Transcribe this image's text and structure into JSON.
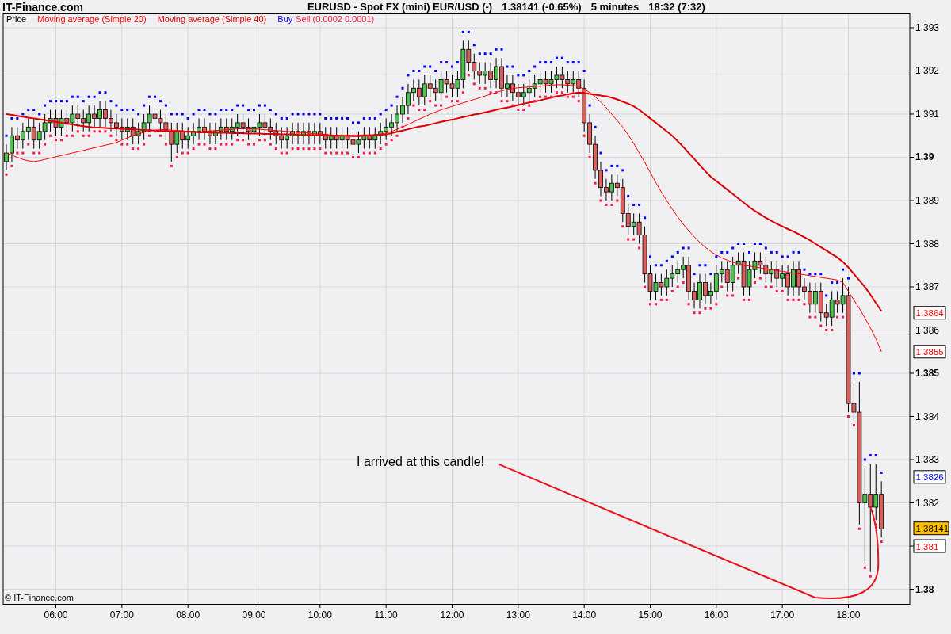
{
  "site": "IT-Finance.com",
  "title": [
    "EURUSD - Spot FX (mini) EUR/USD (-)",
    "1.38141 (-0.65%)",
    "5 minutes",
    "18:32 (7:32)"
  ],
  "chart": {
    "legend": [
      {
        "label": "Price",
        "color": "#000000"
      }
    ],
    "copyright": "© IT-Finance.com",
    "price_tags": [
      {
        "label": "1.3864",
        "color": "#ff0000",
        "kind": "plain"
      },
      {
        "label": "1.3855",
        "color": "#ff0000",
        "kind": "plain"
      },
      {
        "label": "1.3826",
        "color": "#0000ff",
        "kind": "plain"
      },
      {
        "label": "1.38141",
        "color": "#ffc000",
        "kind": "current"
      },
      {
        "label": "1.381",
        "color": "#ff0000",
        "kind": "plain"
      }
    ],
    "chart_data": {
      "type": "candlestick",
      "grid": true,
      "xlim": [
        312.12,
        1135.8
      ],
      "ylim": [
        1.379661,
        1.39333
      ],
      "x": [
        315,
        320,
        325,
        330,
        335,
        340,
        345,
        350,
        355,
        360,
        365,
        370,
        375,
        380,
        385,
        390,
        395,
        400,
        405,
        410,
        415,
        420,
        425,
        430,
        435,
        440,
        445,
        450,
        455,
        460,
        465,
        470,
        475,
        480,
        485,
        490,
        495,
        500,
        505,
        510,
        515,
        520,
        525,
        530,
        535,
        540,
        545,
        550,
        555,
        560,
        565,
        570,
        575,
        580,
        585,
        590,
        595,
        600,
        605,
        610,
        615,
        620,
        625,
        630,
        635,
        640,
        645,
        650,
        655,
        660,
        665,
        670,
        675,
        680,
        685,
        690,
        695,
        700,
        705,
        710,
        715,
        720,
        725,
        730,
        735,
        740,
        745,
        750,
        755,
        760,
        765,
        770,
        775,
        780,
        785,
        790,
        795,
        800,
        805,
        810,
        815,
        820,
        825,
        830,
        835,
        840,
        845,
        850,
        855,
        860,
        865,
        870,
        875,
        880,
        885,
        890,
        895,
        900,
        905,
        910,
        915,
        920,
        925,
        930,
        935,
        940,
        945,
        950,
        955,
        960,
        965,
        970,
        975,
        980,
        985,
        990,
        995,
        1000,
        1005,
        1010,
        1015,
        1020,
        1025,
        1030,
        1035,
        1040,
        1045,
        1050,
        1055,
        1060,
        1065,
        1070,
        1075,
        1080,
        1085,
        1090,
        1095,
        1100,
        1105,
        1110
      ],
      "ohlc": [
        [
          1.3899,
          1.3903,
          1.3897,
          1.3901
        ],
        [
          1.3901,
          1.3907,
          1.3899,
          1.3905
        ],
        [
          1.3905,
          1.3907,
          1.3902,
          1.3904
        ],
        [
          1.3904,
          1.3908,
          1.3902,
          1.3906
        ],
        [
          1.3906,
          1.3909,
          1.3904,
          1.3907
        ],
        [
          1.3907,
          1.3909,
          1.3902,
          1.3904
        ],
        [
          1.3904,
          1.3908,
          1.3902,
          1.3906
        ],
        [
          1.3906,
          1.391,
          1.3904,
          1.3908
        ],
        [
          1.3908,
          1.3911,
          1.3906,
          1.3909
        ],
        [
          1.3909,
          1.3911,
          1.3905,
          1.3907
        ],
        [
          1.3907,
          1.3911,
          1.3905,
          1.3909
        ],
        [
          1.3909,
          1.3911,
          1.3906,
          1.3908
        ],
        [
          1.3908,
          1.3912,
          1.3906,
          1.391
        ],
        [
          1.391,
          1.3912,
          1.3907,
          1.3909
        ],
        [
          1.3909,
          1.3911,
          1.3906,
          1.3908
        ],
        [
          1.3908,
          1.3912,
          1.3906,
          1.391
        ],
        [
          1.391,
          1.3912,
          1.3907,
          1.3909
        ],
        [
          1.3909,
          1.3913,
          1.3907,
          1.3911
        ],
        [
          1.3911,
          1.3913,
          1.3907,
          1.3909
        ],
        [
          1.3909,
          1.3911,
          1.3906,
          1.3908
        ],
        [
          1.3908,
          1.391,
          1.3905,
          1.3907
        ],
        [
          1.3907,
          1.3909,
          1.3904,
          1.3906
        ],
        [
          1.3906,
          1.3909,
          1.3904,
          1.3907
        ],
        [
          1.3907,
          1.3909,
          1.3903,
          1.3905
        ],
        [
          1.3905,
          1.3908,
          1.3903,
          1.3906
        ],
        [
          1.3906,
          1.391,
          1.3904,
          1.3908
        ],
        [
          1.3908,
          1.3912,
          1.3906,
          1.391
        ],
        [
          1.391,
          1.3912,
          1.3907,
          1.3909
        ],
        [
          1.3909,
          1.3911,
          1.3906,
          1.3908
        ],
        [
          1.3908,
          1.391,
          1.3904,
          1.3906
        ],
        [
          1.3906,
          1.3908,
          1.3899,
          1.3903
        ],
        [
          1.3903,
          1.3908,
          1.3901,
          1.3906
        ],
        [
          1.3906,
          1.3908,
          1.3902,
          1.3904
        ],
        [
          1.3904,
          1.3907,
          1.3902,
          1.3905
        ],
        [
          1.3905,
          1.3908,
          1.3903,
          1.3906
        ],
        [
          1.3906,
          1.3909,
          1.3904,
          1.3907
        ],
        [
          1.3907,
          1.3909,
          1.3904,
          1.3906
        ],
        [
          1.3906,
          1.3908,
          1.3903,
          1.3905
        ],
        [
          1.3905,
          1.3908,
          1.3903,
          1.3906
        ],
        [
          1.3906,
          1.3909,
          1.3904,
          1.3907
        ],
        [
          1.3907,
          1.3909,
          1.3904,
          1.3906
        ],
        [
          1.3906,
          1.3909,
          1.3904,
          1.3907
        ],
        [
          1.3907,
          1.391,
          1.3905,
          1.3908
        ],
        [
          1.3908,
          1.391,
          1.3905,
          1.3907
        ],
        [
          1.3907,
          1.3909,
          1.3904,
          1.3906
        ],
        [
          1.3906,
          1.3909,
          1.3904,
          1.3907
        ],
        [
          1.3907,
          1.391,
          1.3905,
          1.3908
        ],
        [
          1.3908,
          1.391,
          1.3905,
          1.3907
        ],
        [
          1.3907,
          1.3909,
          1.3904,
          1.3906
        ],
        [
          1.3906,
          1.3908,
          1.3903,
          1.3905
        ],
        [
          1.3905,
          1.3907,
          1.3902,
          1.3904
        ],
        [
          1.3904,
          1.3907,
          1.3902,
          1.3905
        ],
        [
          1.3905,
          1.3908,
          1.3903,
          1.3906
        ],
        [
          1.3906,
          1.3908,
          1.3903,
          1.3905
        ],
        [
          1.3905,
          1.3908,
          1.3903,
          1.3906
        ],
        [
          1.3906,
          1.3908,
          1.3903,
          1.3905
        ],
        [
          1.3905,
          1.3908,
          1.3903,
          1.3906
        ],
        [
          1.3906,
          1.3908,
          1.3903,
          1.3905
        ],
        [
          1.3905,
          1.3907,
          1.3902,
          1.3904
        ],
        [
          1.3904,
          1.3907,
          1.3902,
          1.3905
        ],
        [
          1.3905,
          1.3907,
          1.3902,
          1.3904
        ],
        [
          1.3904,
          1.3907,
          1.3902,
          1.3905
        ],
        [
          1.3905,
          1.3907,
          1.3902,
          1.3904
        ],
        [
          1.3904,
          1.3906,
          1.3901,
          1.3903
        ],
        [
          1.3903,
          1.3906,
          1.3901,
          1.3904
        ],
        [
          1.3904,
          1.3907,
          1.3902,
          1.3905
        ],
        [
          1.3905,
          1.3907,
          1.3902,
          1.3904
        ],
        [
          1.3904,
          1.3907,
          1.3902,
          1.3905
        ],
        [
          1.3905,
          1.3908,
          1.3903,
          1.3906
        ],
        [
          1.3906,
          1.3909,
          1.3904,
          1.3907
        ],
        [
          1.3907,
          1.391,
          1.3905,
          1.3908
        ],
        [
          1.3908,
          1.3912,
          1.3906,
          1.391
        ],
        [
          1.391,
          1.3914,
          1.3908,
          1.3912
        ],
        [
          1.3912,
          1.3917,
          1.391,
          1.3915
        ],
        [
          1.3915,
          1.3918,
          1.3913,
          1.3916
        ],
        [
          1.3916,
          1.3918,
          1.3912,
          1.3914
        ],
        [
          1.3914,
          1.3919,
          1.3912,
          1.3917
        ],
        [
          1.3917,
          1.3919,
          1.3914,
          1.3916
        ],
        [
          1.3916,
          1.3918,
          1.3913,
          1.3915
        ],
        [
          1.3915,
          1.392,
          1.3913,
          1.3918
        ],
        [
          1.3918,
          1.392,
          1.3915,
          1.3917
        ],
        [
          1.3917,
          1.3919,
          1.3914,
          1.3916
        ],
        [
          1.3916,
          1.392,
          1.3914,
          1.3918
        ],
        [
          1.3918,
          1.3927,
          1.3916,
          1.3925
        ],
        [
          1.3925,
          1.3927,
          1.392,
          1.3922
        ],
        [
          1.3922,
          1.3924,
          1.3918,
          1.392
        ],
        [
          1.392,
          1.3922,
          1.3917,
          1.3919
        ],
        [
          1.3919,
          1.3922,
          1.3917,
          1.392
        ],
        [
          1.392,
          1.3922,
          1.3916,
          1.3918
        ],
        [
          1.3918,
          1.3923,
          1.3916,
          1.3921
        ],
        [
          1.3921,
          1.3923,
          1.3914,
          1.3916
        ],
        [
          1.3916,
          1.3919,
          1.3914,
          1.3917
        ],
        [
          1.3917,
          1.3919,
          1.3913,
          1.3915
        ],
        [
          1.3915,
          1.3917,
          1.3912,
          1.3914
        ],
        [
          1.3914,
          1.3917,
          1.3912,
          1.3915
        ],
        [
          1.3915,
          1.3918,
          1.3913,
          1.3916
        ],
        [
          1.3916,
          1.3919,
          1.3914,
          1.3917
        ],
        [
          1.3917,
          1.392,
          1.3915,
          1.3918
        ],
        [
          1.3918,
          1.392,
          1.3915,
          1.3917
        ],
        [
          1.3917,
          1.392,
          1.3915,
          1.3918
        ],
        [
          1.3918,
          1.3921,
          1.3916,
          1.3919
        ],
        [
          1.3919,
          1.3921,
          1.3916,
          1.3918
        ],
        [
          1.3918,
          1.392,
          1.3915,
          1.3917
        ],
        [
          1.3917,
          1.392,
          1.3915,
          1.3918
        ],
        [
          1.3918,
          1.392,
          1.3914,
          1.3916
        ],
        [
          1.3916,
          1.3918,
          1.3906,
          1.3908
        ],
        [
          1.3908,
          1.391,
          1.3901,
          1.3903
        ],
        [
          1.3903,
          1.3905,
          1.3895,
          1.3897
        ],
        [
          1.3897,
          1.3899,
          1.3891,
          1.3893
        ],
        [
          1.3893,
          1.3895,
          1.389,
          1.3892
        ],
        [
          1.3892,
          1.3896,
          1.389,
          1.3894
        ],
        [
          1.3894,
          1.3896,
          1.3891,
          1.3893
        ],
        [
          1.3893,
          1.3895,
          1.3885,
          1.3887
        ],
        [
          1.3887,
          1.3889,
          1.3882,
          1.3884
        ],
        [
          1.3884,
          1.3887,
          1.3882,
          1.3885
        ],
        [
          1.3885,
          1.3887,
          1.388,
          1.3882
        ],
        [
          1.3882,
          1.3884,
          1.3871,
          1.3873
        ],
        [
          1.3873,
          1.3875,
          1.3867,
          1.3869
        ],
        [
          1.3869,
          1.3873,
          1.3867,
          1.3871
        ],
        [
          1.3871,
          1.3873,
          1.3868,
          1.387
        ],
        [
          1.387,
          1.3874,
          1.3868,
          1.3872
        ],
        [
          1.3872,
          1.3875,
          1.387,
          1.3873
        ],
        [
          1.3873,
          1.3876,
          1.3871,
          1.3874
        ],
        [
          1.3874,
          1.3877,
          1.3872,
          1.3875
        ],
        [
          1.3875,
          1.3877,
          1.3867,
          1.3869
        ],
        [
          1.3869,
          1.3871,
          1.3865,
          1.3867
        ],
        [
          1.3867,
          1.3873,
          1.3865,
          1.3871
        ],
        [
          1.3871,
          1.3873,
          1.3866,
          1.3868
        ],
        [
          1.3868,
          1.3871,
          1.3866,
          1.3869
        ],
        [
          1.3869,
          1.3875,
          1.3867,
          1.3873
        ],
        [
          1.3873,
          1.3876,
          1.3871,
          1.3874
        ],
        [
          1.3874,
          1.3876,
          1.3869,
          1.3871
        ],
        [
          1.3871,
          1.3877,
          1.3869,
          1.3875
        ],
        [
          1.3875,
          1.3878,
          1.3873,
          1.3876
        ],
        [
          1.3876,
          1.3878,
          1.3868,
          1.387
        ],
        [
          1.387,
          1.3876,
          1.3868,
          1.3874
        ],
        [
          1.3874,
          1.3878,
          1.3872,
          1.3876
        ],
        [
          1.3876,
          1.3878,
          1.3873,
          1.3875
        ],
        [
          1.3875,
          1.3877,
          1.3871,
          1.3873
        ],
        [
          1.3873,
          1.3876,
          1.3871,
          1.3874
        ],
        [
          1.3874,
          1.3876,
          1.387,
          1.3872
        ],
        [
          1.3872,
          1.3875,
          1.387,
          1.3873
        ],
        [
          1.3873,
          1.3875,
          1.3868,
          1.387
        ],
        [
          1.387,
          1.3876,
          1.3868,
          1.3874
        ],
        [
          1.3874,
          1.3876,
          1.3868,
          1.387
        ],
        [
          1.387,
          1.3872,
          1.3867,
          1.3869
        ],
        [
          1.3869,
          1.3871,
          1.3864,
          1.3866
        ],
        [
          1.3866,
          1.3871,
          1.3864,
          1.3869
        ],
        [
          1.3869,
          1.3871,
          1.3862,
          1.3864
        ],
        [
          1.3864,
          1.3866,
          1.3861,
          1.3863
        ],
        [
          1.3863,
          1.3869,
          1.3861,
          1.3867
        ],
        [
          1.3867,
          1.3869,
          1.3864,
          1.3866
        ],
        [
          1.3866,
          1.3872,
          1.3864,
          1.3868
        ],
        [
          1.3868,
          1.387,
          1.3841,
          1.3843
        ],
        [
          1.3843,
          1.3848,
          1.3839,
          1.3841
        ],
        [
          1.3841,
          1.3848,
          1.3815,
          1.382
        ],
        [
          1.382,
          1.3828,
          1.3806,
          1.3822
        ],
        [
          1.3822,
          1.3829,
          1.3804,
          1.3819
        ],
        [
          1.3819,
          1.3829,
          1.3816,
          1.3822
        ],
        [
          1.3822,
          1.3825,
          1.3812,
          1.3814
        ]
      ],
      "series": [
        {
          "name": "Moving average (Simple 20)",
          "type": "line",
          "color": "#ff0000",
          "values": [
            1.3901,
            1.39005,
            1.39,
            1.38995,
            1.38992,
            1.3899,
            1.38992,
            1.38995,
            1.38998,
            1.39001,
            1.39004,
            1.39007,
            1.3901,
            1.39013,
            1.39016,
            1.39019,
            1.39022,
            1.39025,
            1.39028,
            1.39031,
            1.39034,
            1.3904,
            1.39045,
            1.3905,
            1.39054,
            1.39058,
            1.39061,
            1.39063,
            1.39064,
            1.39064,
            1.39063,
            1.39062,
            1.39061,
            1.3906,
            1.39059,
            1.39059,
            1.3906,
            1.39061,
            1.39062,
            1.39063,
            1.39064,
            1.39065,
            1.39066,
            1.39066,
            1.39066,
            1.39066,
            1.39065,
            1.39064,
            1.39063,
            1.39062,
            1.39061,
            1.3906,
            1.39059,
            1.39058,
            1.39057,
            1.39056,
            1.39055,
            1.39054,
            1.39053,
            1.39052,
            1.39051,
            1.3905,
            1.39049,
            1.39048,
            1.39048,
            1.39049,
            1.3905,
            1.39052,
            1.39054,
            1.39056,
            1.3906,
            1.39065,
            1.3907,
            1.39076,
            1.39082,
            1.39088,
            1.39094,
            1.391,
            1.39105,
            1.3911,
            1.39114,
            1.39118,
            1.39122,
            1.39126,
            1.3913,
            1.39134,
            1.39138,
            1.39142,
            1.39146,
            1.3915,
            1.39154,
            1.39157,
            1.39159,
            1.39161,
            1.39162,
            1.39163,
            1.39164,
            1.39165,
            1.39166,
            1.39167,
            1.39168,
            1.39168,
            1.39167,
            1.39166,
            1.39164,
            1.39158,
            1.3915,
            1.3914,
            1.39128,
            1.39115,
            1.391,
            1.39085,
            1.3907,
            1.39052,
            1.39032,
            1.3901,
            1.38988,
            1.38965,
            1.38942,
            1.3892,
            1.389,
            1.3888,
            1.38862,
            1.38845,
            1.3883,
            1.38816,
            1.38803,
            1.38792,
            1.38782,
            1.38774,
            1.38767,
            1.38762,
            1.38757,
            1.38753,
            1.3875,
            1.38748,
            1.38746,
            1.38744,
            1.38742,
            1.3874,
            1.38738,
            1.38736,
            1.38734,
            1.38732,
            1.3873,
            1.38728,
            1.38726,
            1.38724,
            1.38722,
            1.3872,
            1.38718,
            1.38716,
            1.3871,
            1.3869,
            1.3867,
            1.3865,
            1.38628,
            1.38605,
            1.3858,
            1.3855
          ]
        },
        {
          "name": "Moving average (Simple 40)",
          "type": "line",
          "color": "#dd0000",
          "values": [
            1.391,
            1.39098,
            1.39096,
            1.39094,
            1.39092,
            1.3909,
            1.39088,
            1.39086,
            1.39084,
            1.39082,
            1.3908,
            1.39078,
            1.39076,
            1.39074,
            1.39072,
            1.3907,
            1.39069,
            1.39069,
            1.39068,
            1.39067,
            1.39067,
            1.39066,
            1.39065,
            1.39065,
            1.39064,
            1.39063,
            1.39063,
            1.39062,
            1.39061,
            1.39061,
            1.3906,
            1.3906,
            1.3906,
            1.39059,
            1.39059,
            1.39058,
            1.39058,
            1.39058,
            1.39057,
            1.39057,
            1.39057,
            1.39056,
            1.39056,
            1.39056,
            1.39055,
            1.39055,
            1.39055,
            1.39054,
            1.39054,
            1.39054,
            1.39053,
            1.39053,
            1.39053,
            1.39052,
            1.39052,
            1.39052,
            1.39051,
            1.39051,
            1.39051,
            1.3905,
            1.3905,
            1.3905,
            1.3905,
            1.3905,
            1.3905,
            1.39051,
            1.39051,
            1.39052,
            1.39052,
            1.39053,
            1.39056,
            1.39059,
            1.39062,
            1.39065,
            1.39068,
            1.39071,
            1.39073,
            1.39076,
            1.39079,
            1.39082,
            1.39085,
            1.39087,
            1.3909,
            1.39093,
            1.39096,
            1.39099,
            1.39101,
            1.39104,
            1.39107,
            1.3911,
            1.39113,
            1.39115,
            1.39118,
            1.39121,
            1.39124,
            1.39127,
            1.39129,
            1.39132,
            1.39135,
            1.39138,
            1.39141,
            1.39143,
            1.39146,
            1.39148,
            1.3915,
            1.39149,
            1.39147,
            1.39145,
            1.39143,
            1.39141,
            1.39138,
            1.39134,
            1.39129,
            1.39124,
            1.39118,
            1.3911,
            1.391,
            1.3909,
            1.3908,
            1.3907,
            1.3906,
            1.3905,
            1.39037,
            1.39024,
            1.3901,
            1.38996,
            1.38982,
            1.38968,
            1.38955,
            1.38945,
            1.38935,
            1.38925,
            1.38915,
            1.38905,
            1.38895,
            1.38885,
            1.38876,
            1.38868,
            1.3886,
            1.38853,
            1.38846,
            1.3884,
            1.38834,
            1.38828,
            1.38822,
            1.38815,
            1.38808,
            1.388,
            1.38792,
            1.38784,
            1.38776,
            1.38768,
            1.38758,
            1.38745,
            1.3873,
            1.38715,
            1.387,
            1.38682,
            1.38663,
            1.38644
          ]
        },
        {
          "name": "Buy",
          "type": "scatter",
          "color": "#0000ff",
          "values": [
            1.3905,
            1.3909,
            1.3909,
            1.391,
            1.3911,
            1.3911,
            1.391,
            1.3912,
            1.3913,
            1.3913,
            1.3913,
            1.3913,
            1.3914,
            1.3914,
            1.3913,
            1.3914,
            1.3914,
            1.3915,
            1.3915,
            1.3913,
            1.3912,
            1.3911,
            1.3911,
            1.3911,
            1.391,
            1.3912,
            1.3914,
            1.3914,
            1.3913,
            1.3912,
            1.391,
            1.391,
            1.391,
            1.3909,
            1.391,
            1.3911,
            1.3911,
            1.391,
            1.391,
            1.3911,
            1.3911,
            1.3911,
            1.3912,
            1.3912,
            1.3911,
            1.3911,
            1.3912,
            1.3912,
            1.3911,
            1.391,
            1.3909,
            1.3909,
            1.391,
            1.391,
            1.391,
            1.391,
            1.391,
            1.391,
            1.3909,
            1.3909,
            1.3909,
            1.3909,
            1.3909,
            1.3908,
            1.3908,
            1.3909,
            1.3909,
            1.3909,
            1.391,
            1.3911,
            1.3912,
            1.3914,
            1.3916,
            1.3919,
            1.392,
            1.392,
            1.3921,
            1.3921,
            1.392,
            1.3922,
            1.3922,
            1.3921,
            1.3922,
            1.3929,
            1.3929,
            1.3926,
            1.3924,
            1.3924,
            1.3924,
            1.3925,
            1.3925,
            1.3921,
            1.3921,
            1.3919,
            1.3919,
            1.392,
            1.3921,
            1.3922,
            1.3922,
            1.3922,
            1.3923,
            1.3923,
            1.3922,
            1.3922,
            1.3922,
            1.392,
            1.3912,
            1.3907,
            1.3901,
            1.3897,
            1.3898,
            1.3898,
            1.3897,
            1.3891,
            1.3889,
            1.3889,
            1.3886,
            1.3877,
            1.3875,
            1.3875,
            1.3876,
            1.3877,
            1.3878,
            1.3879,
            1.3879,
            1.3873,
            1.3875,
            1.3875,
            1.3873,
            1.3877,
            1.3878,
            1.3878,
            1.3879,
            1.388,
            1.388,
            1.3878,
            1.388,
            1.388,
            1.3879,
            1.3878,
            1.3878,
            1.3877,
            1.3877,
            1.3878,
            1.3878,
            1.3874,
            1.3873,
            1.3873,
            1.3873,
            1.3868,
            1.3871,
            1.3871,
            1.3874,
            1.3872,
            1.385,
            1.385,
            1.383,
            1.3831,
            1.3831,
            1.3827
          ]
        },
        {
          "name": "Sell (0.0002 0.0001)",
          "type": "scatter",
          "color": "#ff1744",
          "values": [
            1.3896,
            1.3898,
            1.3901,
            1.3901,
            1.3903,
            1.3901,
            1.3901,
            1.3903,
            1.3905,
            1.3904,
            1.3904,
            1.3905,
            1.3905,
            1.3906,
            1.3905,
            1.3905,
            1.3906,
            1.3906,
            1.3906,
            1.3905,
            1.3904,
            1.3903,
            1.3903,
            1.3902,
            1.3902,
            1.3903,
            1.3905,
            1.3906,
            1.3905,
            1.3903,
            1.3898,
            1.39,
            1.3901,
            1.3901,
            1.3902,
            1.3903,
            1.3903,
            1.3902,
            1.3902,
            1.3903,
            1.3903,
            1.3903,
            1.3904,
            1.3904,
            1.3903,
            1.3903,
            1.3904,
            1.3904,
            1.3903,
            1.3902,
            1.3901,
            1.3901,
            1.3902,
            1.3902,
            1.3902,
            1.3902,
            1.3902,
            1.3902,
            1.3901,
            1.3901,
            1.3901,
            1.3901,
            1.3901,
            1.39,
            1.39,
            1.3901,
            1.3901,
            1.3901,
            1.3902,
            1.3903,
            1.3904,
            1.3905,
            1.3907,
            1.3909,
            1.3912,
            1.3911,
            1.3911,
            1.3913,
            1.3912,
            1.3912,
            1.3914,
            1.3913,
            1.3913,
            1.3915,
            1.3919,
            1.3917,
            1.3916,
            1.3916,
            1.3915,
            1.3915,
            1.3913,
            1.3913,
            1.3912,
            1.3911,
            1.3911,
            1.3912,
            1.3913,
            1.3914,
            1.3914,
            1.3914,
            1.3915,
            1.3915,
            1.3914,
            1.3914,
            1.3913,
            1.3905,
            1.39,
            1.3894,
            1.389,
            1.3889,
            1.3889,
            1.389,
            1.3884,
            1.3881,
            1.3881,
            1.3879,
            1.387,
            1.3866,
            1.3866,
            1.3867,
            1.3867,
            1.3869,
            1.387,
            1.3871,
            1.3866,
            1.3864,
            1.3864,
            1.3865,
            1.3865,
            1.3866,
            1.387,
            1.3868,
            1.3868,
            1.3872,
            1.3867,
            1.3867,
            1.3871,
            1.3872,
            1.387,
            1.387,
            1.3869,
            1.3869,
            1.3867,
            1.3867,
            1.3867,
            1.3866,
            1.3863,
            1.3863,
            1.3861,
            1.386,
            1.386,
            1.3863,
            1.3863,
            1.384,
            1.3838,
            1.3814,
            1.3805,
            1.3803,
            1.3815,
            1.3811
          ]
        }
      ],
      "xticks": [
        {
          "value": 360,
          "label": "06:00"
        },
        {
          "value": 420,
          "label": "07:00"
        },
        {
          "value": 480,
          "label": "08:00"
        },
        {
          "value": 540,
          "label": "09:00"
        },
        {
          "value": 600,
          "label": "10:00"
        },
        {
          "value": 660,
          "label": "11:00"
        },
        {
          "value": 720,
          "label": "12:00"
        },
        {
          "value": 780,
          "label": "13:00"
        },
        {
          "value": 840,
          "label": "14:00"
        },
        {
          "value": 900,
          "label": "15:00"
        },
        {
          "value": 960,
          "label": "16:00"
        },
        {
          "value": 1020,
          "label": "17:00"
        },
        {
          "value": 1080,
          "label": "18:00"
        }
      ],
      "yticks": [
        {
          "value": 1.38,
          "label": "1.38"
        },
        1.381,
        {
          "value": 1.382,
          "label": "1.382"
        },
        {
          "value": 1.383,
          "label": "1.383"
        },
        {
          "value": 1.384,
          "label": "1.384"
        },
        {
          "value": 1.385,
          "label": "1.385"
        },
        {
          "value": 1.386,
          "label": "1.386"
        },
        {
          "value": 1.387,
          "label": "1.387"
        },
        {
          "value": 1.388,
          "label": "1.388"
        },
        {
          "value": 1.389,
          "label": "1.389"
        },
        {
          "value": 1.39,
          "label": "1.39"
        },
        {
          "value": 1.391,
          "label": "1.391"
        },
        {
          "value": 1.392,
          "label": "1.392"
        },
        {
          "value": 1.393,
          "label": "1.393"
        }
      ],
      "annotations": [
        "I arrived at this candle!"
      ]
    }
  }
}
